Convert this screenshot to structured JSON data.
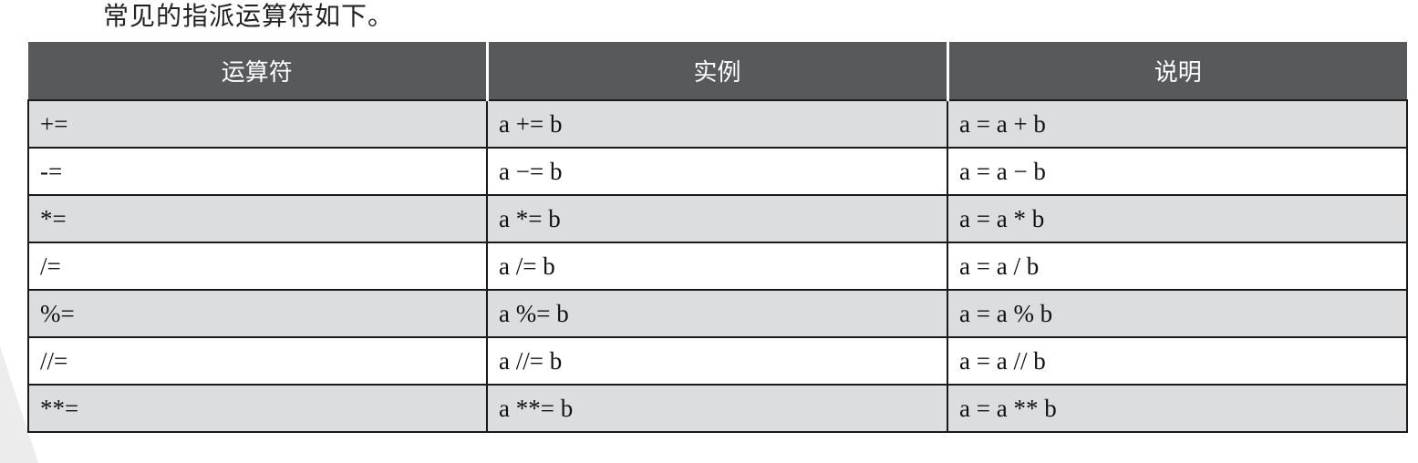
{
  "intro_text": "常见的指派运算符如下。",
  "table": {
    "headers": [
      "运算符",
      "实例",
      "说明"
    ],
    "rows": [
      {
        "operator": "+=",
        "example": "a += b",
        "meaning": "a = a + b"
      },
      {
        "operator": "-=",
        "example": "a −= b",
        "meaning": "a = a − b"
      },
      {
        "operator": "*=",
        "example": "a *= b",
        "meaning": "a = a * b"
      },
      {
        "operator": "/=",
        "example": "a /= b",
        "meaning": "a = a / b"
      },
      {
        "operator": "%=",
        "example": "a %= b",
        "meaning": "a = a % b"
      },
      {
        "operator": "//=",
        "example": "a //= b",
        "meaning": "a = a // b"
      },
      {
        "operator": "**=",
        "example": "a **= b",
        "meaning": "a = a ** b"
      }
    ]
  },
  "colors": {
    "header_bg": "#58595b",
    "header_text": "#ffffff",
    "shaded_row": "#dcdddf",
    "plain_row": "#ffffff",
    "border": "#1a1a1a"
  }
}
